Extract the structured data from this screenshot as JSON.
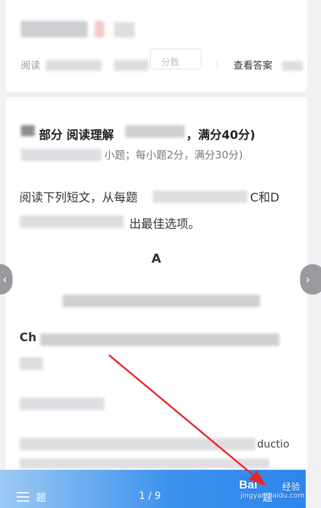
{
  "header": {
    "read_label": "阅读",
    "score_label": "分数",
    "review_label": "查看答案"
  },
  "content": {
    "section_heading": "部分 阅读理解",
    "section_score": "，满分40分)",
    "sub_line": "小题；每小题2分，满分30分)",
    "para_line1": "阅读下列短文，从每题",
    "para_line1_end": "C和D",
    "para_line2_end": "出最佳选项。",
    "passage_label": "A",
    "line_start": "Ch",
    "fragment": "ductio"
  },
  "bottom_bar": {
    "left_label": "题",
    "page_indicator": "1 / 9",
    "right_label": "题"
  },
  "side_nav": {
    "prev_glyph": "‹",
    "next_glyph": "›"
  },
  "watermark": {
    "brand": "Bai",
    "brand_suffix": "经验",
    "url": "jingyan.baidu.com"
  },
  "colors": {
    "bar_start": "#9ccaf3",
    "bar_end": "#2e86ec",
    "annotation_arrow": "#e8262a"
  }
}
